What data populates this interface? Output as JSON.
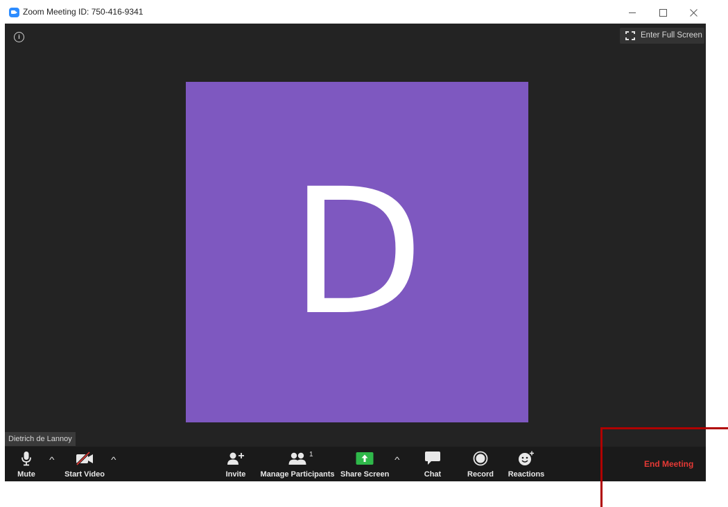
{
  "window": {
    "title": "Zoom Meeting ID: 750-416-9341",
    "controls": [
      "minimize",
      "maximize",
      "close"
    ]
  },
  "stage": {
    "fullscreen_label": "Enter Full Screen",
    "avatar_letter": "D",
    "avatar_color": "#7e58c0",
    "participant_name": "Dietrich de Lannoy"
  },
  "toolbar": {
    "mute_label": "Mute",
    "start_video_label": "Start Video",
    "invite_label": "Invite",
    "manage_participants_label": "Manage Participants",
    "participants_count": "1",
    "share_screen_label": "Share Screen",
    "chat_label": "Chat",
    "record_label": "Record",
    "reactions_label": "Reactions",
    "end_meeting_label": "End Meeting",
    "share_color": "#2fb84a",
    "end_color": "#e53935"
  },
  "icons": [
    "app-icon",
    "info-icon",
    "fullscreen-icon",
    "microphone-icon",
    "video-off-icon",
    "add-person-icon",
    "participants-icon",
    "share-screen-icon",
    "chat-icon",
    "record-icon",
    "reactions-icon"
  ]
}
